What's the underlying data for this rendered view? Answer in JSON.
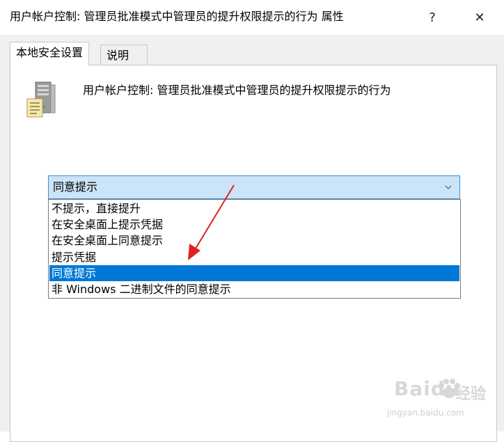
{
  "window": {
    "title": "用户帐户控制: 管理员批准模式中管理员的提升权限提示的行为 属性",
    "help_label": "?",
    "close_label": "✕"
  },
  "tabs": [
    {
      "label": "本地安全设置",
      "active": true
    },
    {
      "label": "说明",
      "active": false
    }
  ],
  "policy": {
    "icon": "server-policy-icon",
    "title": "用户帐户控制: 管理员批准模式中管理员的提升权限提示的行为"
  },
  "combo": {
    "value": "同意提示",
    "arrow": "chevron-down-icon"
  },
  "options": [
    {
      "label": "不提示，直接提升",
      "selected": false
    },
    {
      "label": "在安全桌面上提示凭据",
      "selected": false
    },
    {
      "label": "在安全桌面上同意提示",
      "selected": false
    },
    {
      "label": "提示凭据",
      "selected": false
    },
    {
      "label": "同意提示",
      "selected": true
    },
    {
      "label": "非 Windows 二进制文件的同意提示",
      "selected": false
    }
  ],
  "annotation": {
    "arrow_color": "#e02020"
  },
  "watermark": {
    "brand": "Baidu",
    "brand_cn": "经验",
    "url": "jingyan.baidu.com"
  },
  "colors": {
    "selection": "#0078d7",
    "combo_bg": "#cce4f7",
    "combo_border": "#3c8cd6"
  }
}
